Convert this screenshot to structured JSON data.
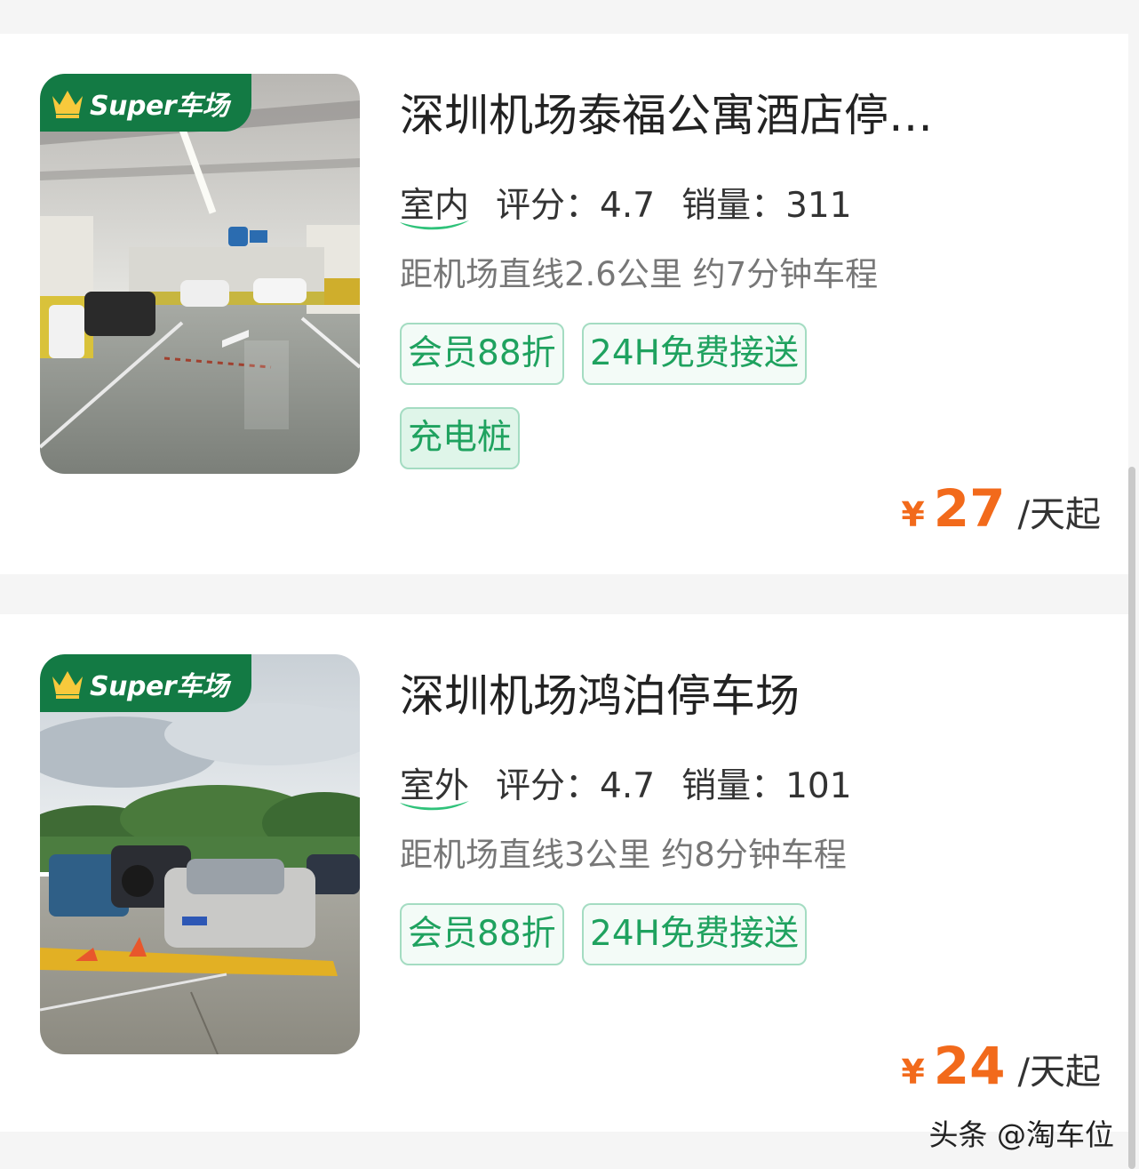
{
  "listings": [
    {
      "badge": "Super车场",
      "title": "深圳机场泰福公寓酒店停车场",
      "location_type": "室内",
      "rating_label": "评分：",
      "rating_value": "4.7",
      "sales_label": "销量：",
      "sales_value": "311",
      "distance": "距机场直线2.6公里 约7分钟车程",
      "tags": [
        "会员88折",
        "24H免费接送",
        "充电桩"
      ],
      "price_symbol": "¥",
      "price": "27",
      "price_unit": "/天起",
      "image": "indoor-parking-garage-photo"
    },
    {
      "badge": "Super车场",
      "title": "深圳机场鸿泊停车场",
      "location_type": "室外",
      "rating_label": "评分：",
      "rating_value": "4.7",
      "sales_label": "销量：",
      "sales_value": "101",
      "distance": "距机场直线3公里 约8分钟车程",
      "tags": [
        "会员88折",
        "24H免费接送"
      ],
      "price_symbol": "¥",
      "price": "24",
      "price_unit": "/天起",
      "image": "outdoor-parking-lot-photo"
    }
  ],
  "watermark": "头条 @淘车位",
  "colors": {
    "accent_green": "#1fa25f",
    "badge_green": "#137a44",
    "price_orange": "#f26a1b"
  }
}
